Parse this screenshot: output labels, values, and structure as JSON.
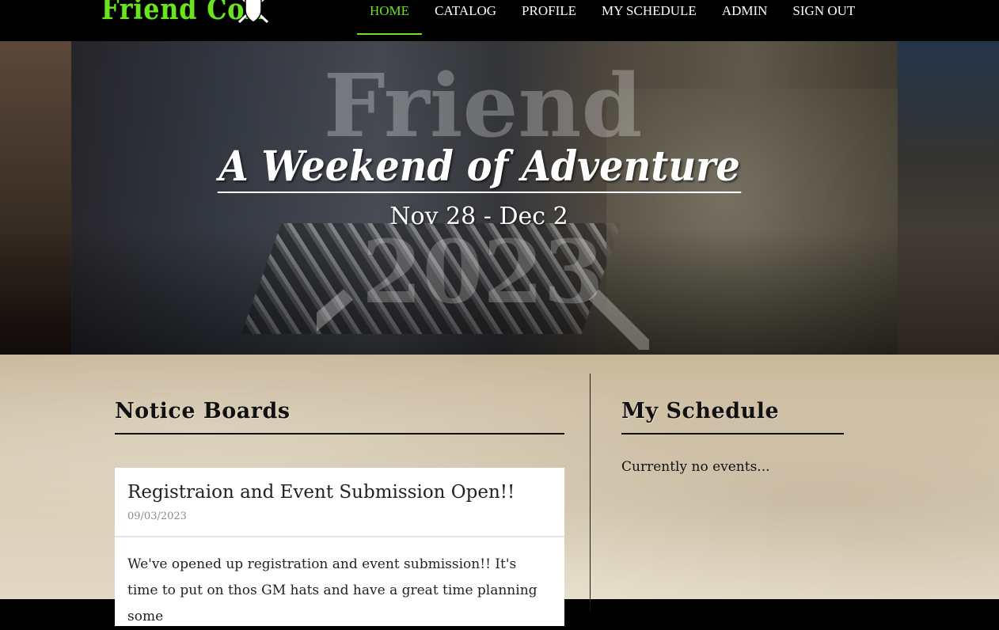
{
  "brand": {
    "name": "Friend Con",
    "logo_icon": "shield-swords-icon",
    "accent_color": "#6be31f"
  },
  "nav": {
    "items": [
      {
        "label": "HOME",
        "active": true
      },
      {
        "label": "CATALOG",
        "active": false
      },
      {
        "label": "PROFILE",
        "active": false
      },
      {
        "label": "MY SCHEDULE",
        "active": false
      },
      {
        "label": "ADMIN",
        "active": false
      },
      {
        "label": "SIGN OUT",
        "active": false
      }
    ]
  },
  "hero": {
    "title": "A Weekend of Adventure",
    "dates": "Nov 28 - Dec 2",
    "watermark_line1": "Friend",
    "watermark_line2": "2023"
  },
  "notice_boards": {
    "heading": "Notice Boards",
    "posts": [
      {
        "title": "Registraion and Event Submission Open!!",
        "date": "09/03/2023",
        "body": "We've opened up registration and event submission!! It's time to put on thos GM hats and have a great time planning some"
      }
    ]
  },
  "my_schedule": {
    "heading": "My Schedule",
    "empty_text": "Currently no events..."
  }
}
